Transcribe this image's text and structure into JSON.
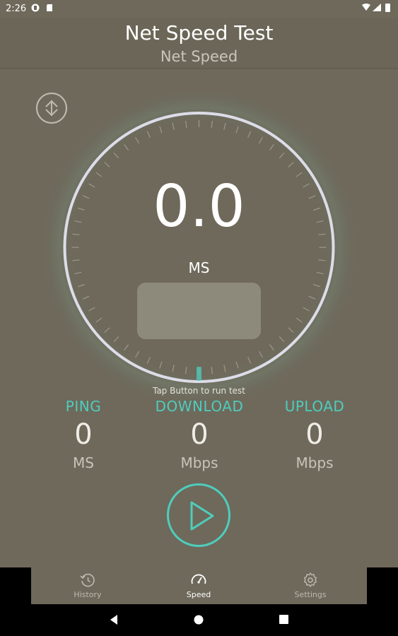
{
  "status_bar": {
    "time": "2:26"
  },
  "app_bar": {
    "title": "Net Speed Test",
    "subtitle": "Net Speed"
  },
  "gauge": {
    "value": "0.0",
    "unit": "MS"
  },
  "hint": "Tap Button to run test",
  "stats": {
    "ping": {
      "label": "PING",
      "value": "0",
      "unit": "MS"
    },
    "download": {
      "label": "DOWNLOAD",
      "value": "0",
      "unit": "Mbps"
    },
    "upload": {
      "label": "UPLOAD",
      "value": "0",
      "unit": "Mbps"
    }
  },
  "bottom_nav": {
    "items": [
      {
        "label": "History",
        "icon": "history-icon"
      },
      {
        "label": "Speed",
        "icon": "speedometer-icon",
        "active": true
      },
      {
        "label": "Settings",
        "icon": "gear-icon"
      }
    ]
  },
  "colors": {
    "background": "#6e695b",
    "accent": "#4ecdbd",
    "dial_ring": "#dcdde8",
    "panel": "#8e8a7b"
  }
}
